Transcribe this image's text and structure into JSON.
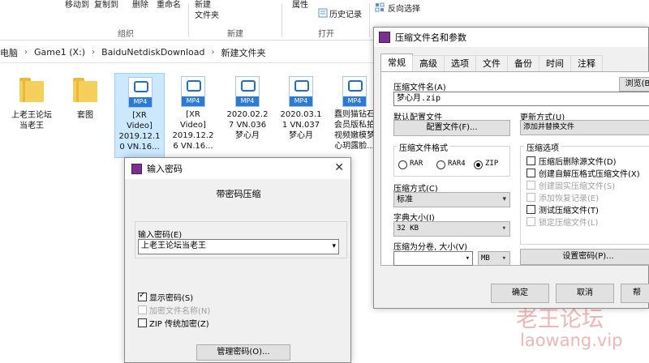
{
  "ribbon": {
    "copy_to": "复制到",
    "move_to": "移动到",
    "delete": "删除",
    "rename": "重命名",
    "new_folder_line1": "新建",
    "new_folder_line2": "文件夹",
    "properties": "属性",
    "history": "历史记录",
    "invert_selection": "反向选择",
    "group_organize": "组织",
    "group_new": "新建",
    "group_open": "打开"
  },
  "address": {
    "crumbs": [
      "电脑",
      "Game1 (X:)",
      "BaiduNetdiskDownload",
      "新建文件夹"
    ]
  },
  "files": [
    {
      "type": "folder",
      "name_lines": [
        "上老王论坛",
        "当老王"
      ]
    },
    {
      "type": "folder",
      "name_lines": [
        "套图"
      ]
    },
    {
      "type": "mp4",
      "badge": "MP4",
      "name_lines": [
        "[XR",
        "Video]",
        "2019.12.1",
        "0 VN.16..."
      ]
    },
    {
      "type": "mp4",
      "badge": "MP4",
      "name_lines": [
        "[XR",
        "Video]",
        "2019.12.2",
        "6 VN.16..."
      ]
    },
    {
      "type": "mp4",
      "badge": "MP4",
      "name_lines": [
        "2020.02.2",
        "7 VN.036",
        "梦心月"
      ]
    },
    {
      "type": "mp4",
      "badge": "MP4",
      "name_lines": [
        "2020.03.1",
        "1 VN.037",
        "梦心月"
      ]
    },
    {
      "type": "mp4",
      "badge": "MP4",
      "name_lines": [
        "蠢则猫钻石",
        "会员版私拍",
        "视频嫩模梦",
        "心玥露脸..."
      ]
    }
  ],
  "rar": {
    "title": "压缩文件名和参数",
    "tabs": [
      "常规",
      "高级",
      "选项",
      "文件",
      "备份",
      "时间",
      "注释"
    ],
    "archive_name_label": "压缩文件名(A)",
    "archive_name_value": "梦心月.zip",
    "browse": "浏览(B)",
    "default_profile_label": "默认配置文件",
    "profile_button": "配置文件(F)...",
    "update_mode_label": "更新方式(U)",
    "update_mode_value": "添加并替换文件",
    "format_label": "压缩文件格式",
    "format_options": [
      "RAR",
      "RAR4",
      "ZIP"
    ],
    "format_selected": "ZIP",
    "method_label": "压缩方式(C)",
    "method_value": "标准",
    "dict_label": "字典大小(I)",
    "dict_value": "32 KB",
    "split_label": "压缩为分卷, 大小(V)",
    "split_unit": "MB",
    "options_label": "压缩选项",
    "options": [
      {
        "label": "压缩后删除源文件(D)",
        "checked": false,
        "disabled": false
      },
      {
        "label": "创建自解压格式压缩文件(X)",
        "checked": false,
        "disabled": false
      },
      {
        "label": "创建固实压缩文件(S)",
        "checked": false,
        "disabled": true
      },
      {
        "label": "添加恢复记录(E)",
        "checked": false,
        "disabled": true
      },
      {
        "label": "测试压缩文件(T)",
        "checked": false,
        "disabled": false
      },
      {
        "label": "锁定压缩文件(L)",
        "checked": false,
        "disabled": true
      }
    ],
    "set_password": "设置密码(P)...",
    "ok": "确定",
    "cancel": "取消",
    "help": "帮"
  },
  "pw": {
    "title": "输入密码",
    "heading": "带密码压缩",
    "input_label": "输入密码(E)",
    "input_value": "上老王论坛当老王",
    "show_password": "显示密码(S)",
    "encrypt_names": "加密文件名称(N)",
    "zip_legacy": "ZIP 传统加密(Z)",
    "manage": "管理密码(O)..."
  },
  "watermark": {
    "line1": "老王论坛",
    "line2": "laowang.vip"
  }
}
